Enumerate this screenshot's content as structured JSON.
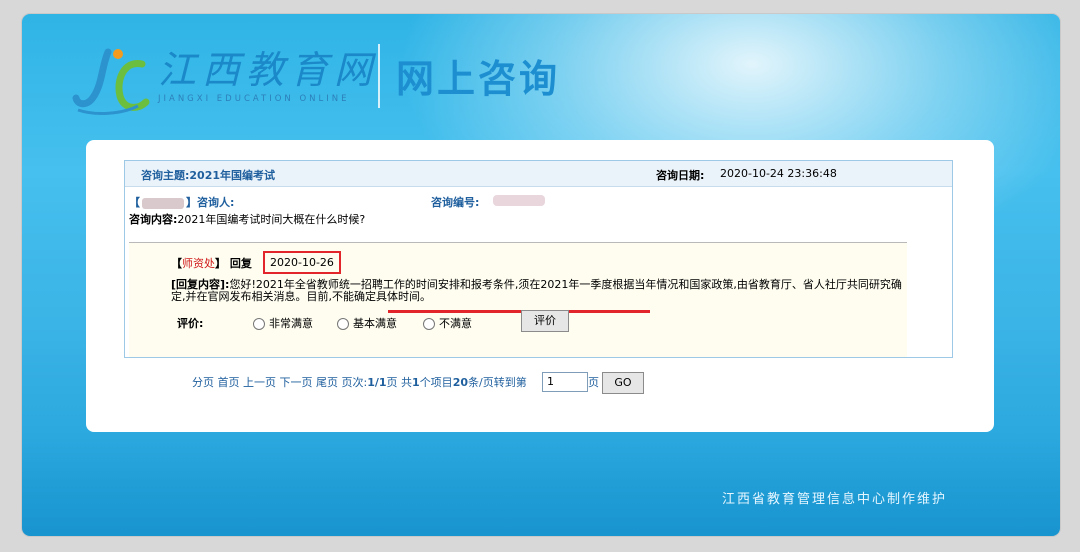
{
  "header": {
    "brand_cn": "江西教育网",
    "brand_en": "JIANGXI EDUCATION ONLINE",
    "title": "网上咨询"
  },
  "consult": {
    "subject_label": "咨询主题:",
    "subject_value": "2021年国编考试",
    "date_label": "咨询日期:",
    "date_value": "2020-10-24 23:36:48",
    "asker_prefix": "【",
    "asker_suffix": "】咨询人:",
    "number_label": "咨询编号:",
    "content_label": "咨询内容:",
    "content_value": "2021年国编考试时间大概在什么时候?"
  },
  "reply": {
    "bracket_open": "【",
    "org": "师资处",
    "bracket_close": "】",
    "reply_label": "回复",
    "date": "2020-10-26",
    "content_label": "[回复内容]:",
    "content_value": "您好!2021年全省教师统一招聘工作的时间安排和报考条件,须在2021年一季度根据当年情况和国家政策,由省教育厅、省人社厅共同研究确定,并在官网发布相关消息。目前,不能确定具体时间。",
    "rating_label": "评价:",
    "options": [
      "非常满意",
      "基本满意",
      "不满意"
    ],
    "rate_button": "评价"
  },
  "pager": {
    "text_a": "分页 首页 上一页 下一页 尾页 页次:",
    "page_status": "1/1",
    "text_b": "页 共",
    "count": "1",
    "text_c": "个项目",
    "per_page": "20",
    "text_d": "条/页转到第",
    "input_value": "1",
    "unit": "页",
    "go_button": "GO"
  },
  "footer": "江西省教育管理信息中心制作维护",
  "colors": {
    "accent": "#1d8fd1",
    "highlight": "#e2242b",
    "link": "#1f5f9e"
  }
}
